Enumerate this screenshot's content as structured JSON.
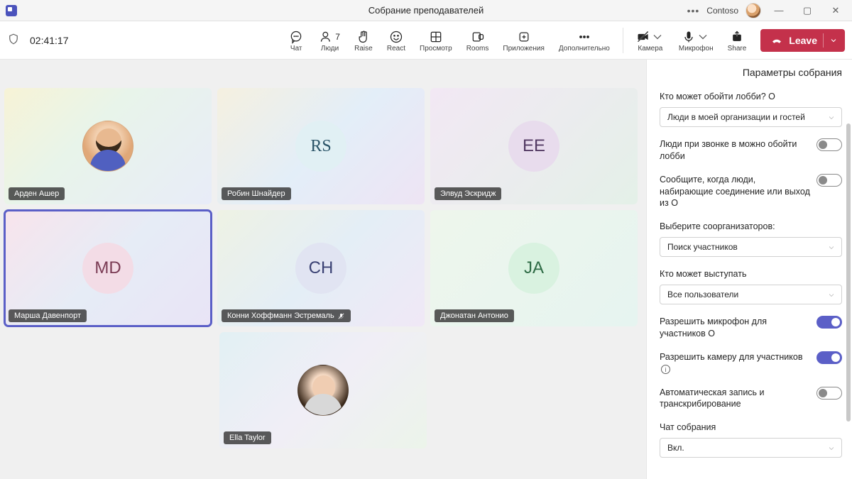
{
  "titlebar": {
    "title": "Собрание преподавателей",
    "tenant": "Contoso"
  },
  "toolbar": {
    "timer": "02:41:17",
    "chat": "Чат",
    "people": "Люди",
    "people_count": "7",
    "raise": "Raise",
    "react": "React",
    "view": "Просмотр",
    "rooms": "Rooms",
    "apps": "Приложения",
    "more": "Дополнительно",
    "camera": "Камера",
    "mic": "Микрофон",
    "share": "Share",
    "leave": "Leave"
  },
  "tiles": [
    {
      "name": "Арден Ашер",
      "initials": "",
      "photo": "arden",
      "muted": false
    },
    {
      "name": "Робин Шнайдер",
      "initials": "RS",
      "cls": "ini-rs",
      "grad": "grad-b"
    },
    {
      "name": "Элвуд Эскридж",
      "initials": "EE",
      "cls": "ini-ee",
      "grad": "grad-c"
    },
    {
      "name": "Марша Давенпорт",
      "initials": "MD",
      "cls": "ini-md",
      "grad": "grad-d",
      "active": true
    },
    {
      "name": "Конни Хоффманн Эстремаль",
      "initials": "CH",
      "cls": "ini-ch",
      "grad": "grad-e",
      "muted": true
    },
    {
      "name": "Джонатан Антонио",
      "initials": "JA",
      "cls": "ini-ja",
      "grad": "grad-f"
    },
    {
      "name": "Ella Taylor",
      "initials": "",
      "photo": "ella",
      "grad": "grad-g"
    }
  ],
  "panel": {
    "title": "Параметры собрания",
    "bypass_label": "Кто может обойти лобби?",
    "bypass_value": "Люди в моей организации и гостей",
    "dialin_label": "Люди при звонке в можно обойти лобби",
    "announce_label": "Сообщите, когда люди, набирающие соединение или выход из",
    "coorg_label": "Выберите соорганизаторов:",
    "coorg_value": "Поиск участников",
    "present_label": "Кто может выступать",
    "present_value": "Все пользователи",
    "allow_mic_label": "Разрешить микрофон для участников",
    "allow_cam_label": "Разрешить камеру для участников",
    "record_label": "Автоматическая запись и транскрибирование",
    "chat_label": "Чат собрания",
    "chat_value": "Вкл.",
    "info_glyph": "i",
    "o_glyph": "О"
  }
}
